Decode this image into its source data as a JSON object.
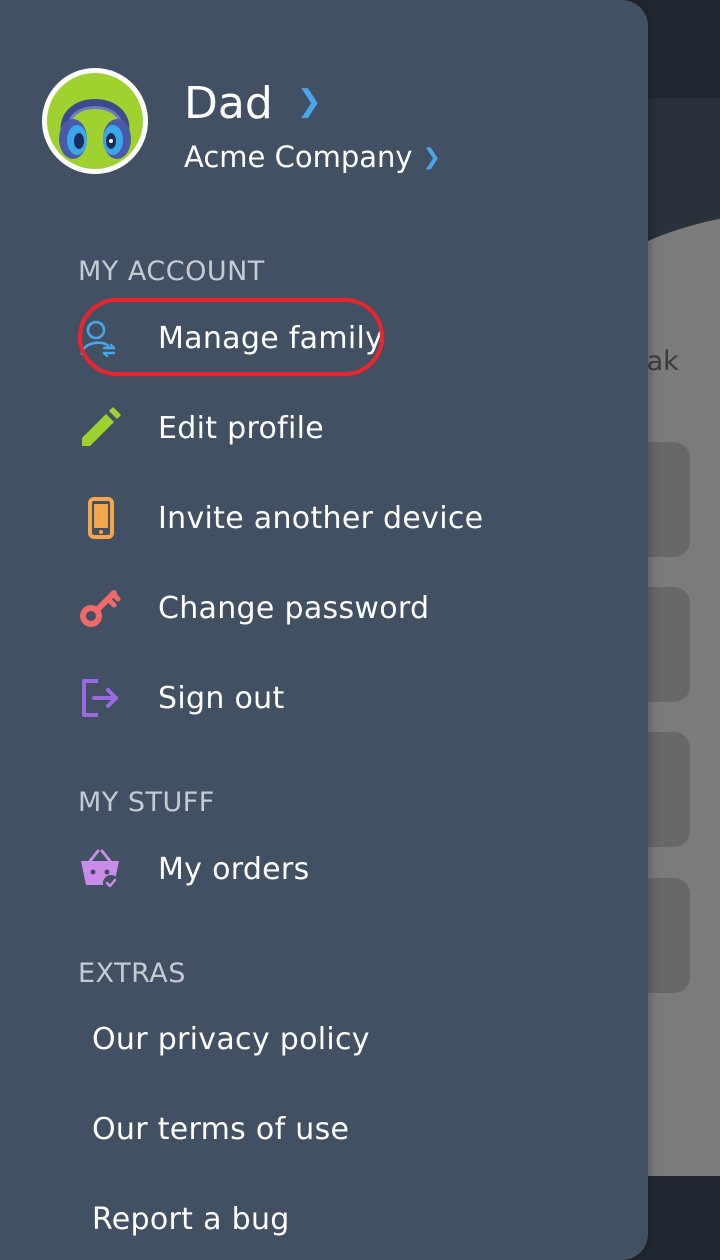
{
  "background": {
    "partial_text": "eak"
  },
  "profile": {
    "name": "Dad",
    "company": "Acme Company",
    "avatar_icon": "headphones-avatar"
  },
  "sections": {
    "account": {
      "title": "MY ACCOUNT",
      "items": [
        {
          "label": "Manage family",
          "icon": "manage-family-icon",
          "color": "#4aa6ea"
        },
        {
          "label": "Edit profile",
          "icon": "pencil-icon",
          "color": "#9fd22e"
        },
        {
          "label": "Invite another device",
          "icon": "phone-icon",
          "color": "#f3a64a"
        },
        {
          "label": "Change password",
          "icon": "key-icon",
          "color": "#f06a6a"
        },
        {
          "label": "Sign out",
          "icon": "sign-out-icon",
          "color": "#9a6be0"
        }
      ]
    },
    "stuff": {
      "title": "MY STUFF",
      "items": [
        {
          "label": "My orders",
          "icon": "basket-icon",
          "color": "#c98ce8"
        }
      ]
    },
    "extras": {
      "title": "EXTRAS",
      "items": [
        {
          "label": "Our privacy policy"
        },
        {
          "label": "Our terms of use"
        },
        {
          "label": "Report a bug"
        }
      ]
    }
  },
  "colors": {
    "drawer_bg": "#425063",
    "accent_blue": "#4aa6ea",
    "highlight_red": "#e8262e"
  }
}
